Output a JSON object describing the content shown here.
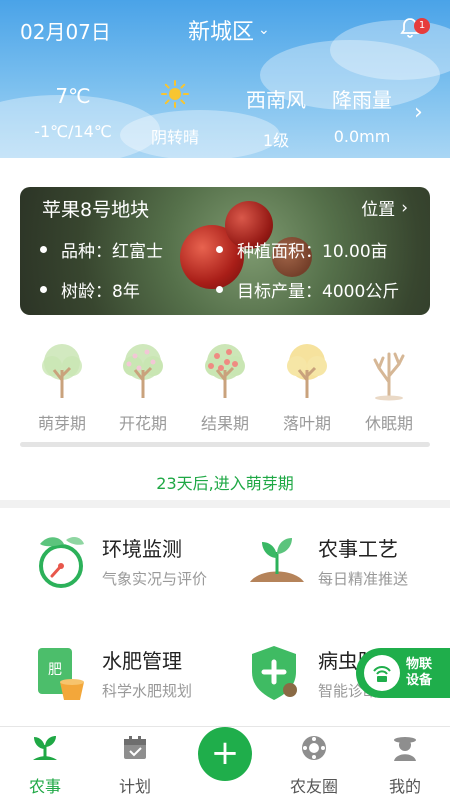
{
  "header": {
    "date": "02月07日",
    "district": "新城区",
    "notification_count": "1"
  },
  "weather": [
    {
      "top": "7℃",
      "bottom": "-1℃/14℃"
    },
    {
      "icon": "sun-icon",
      "bottom": "阴转晴"
    },
    {
      "top": "西南风",
      "bottom": "1级"
    },
    {
      "top": "降雨量",
      "bottom": "0.0mm"
    }
  ],
  "plot": {
    "title": "苹果8号地块",
    "location_label": "位置",
    "variety": "品种：红富士",
    "area": "种植面积：10.00亩",
    "age": "树龄：8年",
    "target_yield": "目标产量：4000公斤"
  },
  "stages": [
    "萌芽期",
    "开花期",
    "结果期",
    "落叶期",
    "休眠期"
  ],
  "countdown": "23天后,进入萌芽期",
  "features": [
    {
      "title": "环境监测",
      "subtitle": "气象实况与评价",
      "icon": "gauge-icon"
    },
    {
      "title": "农事工艺",
      "subtitle": "每日精准推送",
      "icon": "sprout-icon"
    },
    {
      "title": "水肥管理",
      "subtitle": "科学水肥规划",
      "icon": "fertilizer-icon",
      "icon_text": "肥"
    },
    {
      "title": "病虫防",
      "subtitle": "智能诊断",
      "icon": "shield-icon"
    }
  ],
  "iot_button": {
    "line1": "物联",
    "line2": "设备"
  },
  "nav": [
    {
      "label": "农事",
      "icon": "farm-icon",
      "active": true
    },
    {
      "label": "计划",
      "icon": "calendar-icon"
    },
    {
      "label": "",
      "icon": "plus-icon"
    },
    {
      "label": "农友圈",
      "icon": "circle-icon"
    },
    {
      "label": "我的",
      "icon": "user-icon"
    }
  ],
  "colors": {
    "accent": "#1fae4b",
    "header_top": "#4aa3e8",
    "badge": "#e63c3c"
  }
}
